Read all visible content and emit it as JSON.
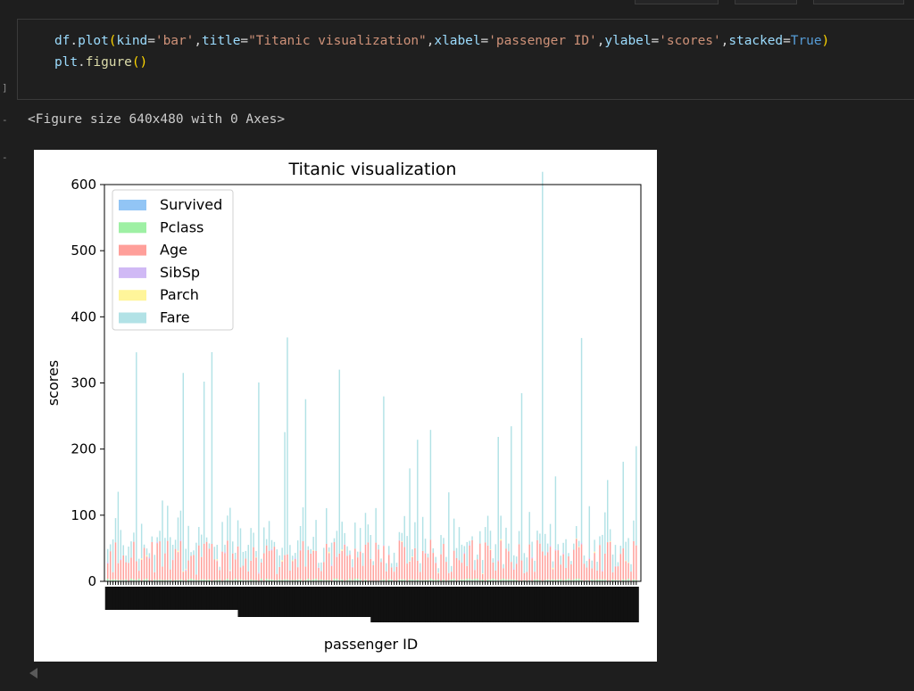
{
  "cells": {
    "execution_marker": "]",
    "output_marker": "-",
    "code": {
      "line1": [
        {
          "t": "df",
          "c": "var"
        },
        {
          "t": ".",
          "c": "plain"
        },
        {
          "t": "plot",
          "c": "var"
        },
        {
          "t": "(",
          "c": "paren"
        },
        {
          "t": "kind",
          "c": "var"
        },
        {
          "t": "=",
          "c": "plain"
        },
        {
          "t": "'bar'",
          "c": "str"
        },
        {
          "t": ",",
          "c": "plain"
        },
        {
          "t": "title",
          "c": "var"
        },
        {
          "t": "=",
          "c": "plain"
        },
        {
          "t": "\"Titanic visualization\"",
          "c": "str"
        },
        {
          "t": ",",
          "c": "plain"
        },
        {
          "t": "xlabel",
          "c": "var"
        },
        {
          "t": "=",
          "c": "plain"
        },
        {
          "t": "'passenger ID'",
          "c": "str"
        },
        {
          "t": ",",
          "c": "plain"
        },
        {
          "t": "ylabel",
          "c": "var"
        },
        {
          "t": "=",
          "c": "plain"
        },
        {
          "t": "'scores'",
          "c": "str"
        },
        {
          "t": ",",
          "c": "plain"
        },
        {
          "t": "stacked",
          "c": "var"
        },
        {
          "t": "=",
          "c": "plain"
        },
        {
          "t": "True",
          "c": "kw"
        },
        {
          "t": ")",
          "c": "paren"
        }
      ],
      "line2": [
        {
          "t": "plt",
          "c": "var"
        },
        {
          "t": ".",
          "c": "plain"
        },
        {
          "t": "figure",
          "c": "fn"
        },
        {
          "t": "()",
          "c": "paren"
        }
      ]
    },
    "output_text": "<Figure size 640x480 with 0 Axes>"
  },
  "colors": {
    "Survived": "#92c5f5",
    "Pclass": "#9ef0a4",
    "Age": "#ff9f9a",
    "SibSp": "#d0b9f5",
    "Parch": "#fff59a",
    "Fare": "#b2e2e6"
  },
  "chart_data": {
    "type": "bar",
    "stacked": true,
    "title": "Titanic visualization",
    "xlabel": "passenger ID",
    "ylabel": "scores",
    "ylim": [
      0,
      600
    ],
    "yticks": [
      0,
      100,
      200,
      300,
      400,
      500,
      600
    ],
    "legend_position": "top-left",
    "series": [
      {
        "name": "Survived"
      },
      {
        "name": "Pclass"
      },
      {
        "name": "Age"
      },
      {
        "name": "SibSp"
      },
      {
        "name": "Parch"
      },
      {
        "name": "Fare"
      }
    ],
    "category_count": 204,
    "fare_peaks": [
      {
        "i": 11,
        "v": 316
      },
      {
        "i": 29,
        "v": 300
      },
      {
        "i": 37,
        "v": 245
      },
      {
        "i": 40,
        "v": 290
      },
      {
        "i": 58,
        "v": 287
      },
      {
        "i": 68,
        "v": 186
      },
      {
        "i": 69,
        "v": 328
      },
      {
        "i": 76,
        "v": 253
      },
      {
        "i": 89,
        "v": 278
      },
      {
        "i": 106,
        "v": 225
      },
      {
        "i": 116,
        "v": 140
      },
      {
        "i": 119,
        "v": 183
      },
      {
        "i": 124,
        "v": 166
      },
      {
        "i": 131,
        "v": 122
      },
      {
        "i": 150,
        "v": 186
      },
      {
        "i": 155,
        "v": 205
      },
      {
        "i": 159,
        "v": 253
      },
      {
        "i": 167,
        "v": 574
      },
      {
        "i": 182,
        "v": 310
      },
      {
        "i": 198,
        "v": 131
      },
      {
        "i": 203,
        "v": 150
      },
      {
        "i": 4,
        "v": 108
      },
      {
        "i": 21,
        "v": 100
      },
      {
        "i": 47,
        "v": 94
      },
      {
        "i": 185,
        "v": 78
      },
      {
        "i": 192,
        "v": 94
      },
      {
        "i": 172,
        "v": 110
      }
    ]
  }
}
